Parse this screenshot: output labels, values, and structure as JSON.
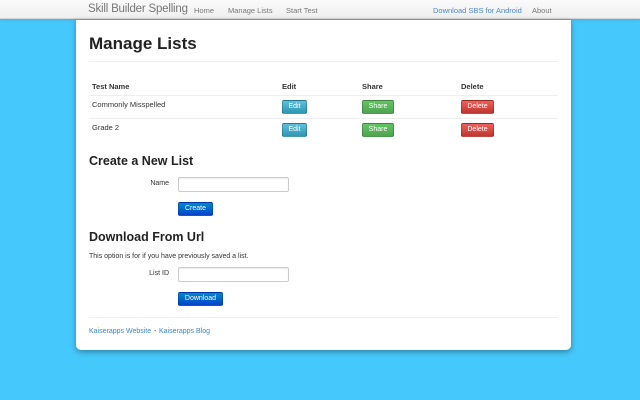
{
  "navbar": {
    "brand": "Skill Builder Spelling",
    "links": [
      "Home",
      "Manage Lists",
      "Start Test"
    ],
    "right_links": [
      "Download SBS for Android",
      "About"
    ]
  },
  "page": {
    "title": "Manage Lists"
  },
  "table": {
    "headers": [
      "Test Name",
      "Edit",
      "Share",
      "Delete"
    ],
    "rows": [
      {
        "name": "Commonly Misspelled",
        "edit": "Edit",
        "share": "Share",
        "delete": "Delete"
      },
      {
        "name": "Grade 2",
        "edit": "Edit",
        "share": "Share",
        "delete": "Delete"
      }
    ]
  },
  "create": {
    "title": "Create a New List",
    "name_label": "Name",
    "name_value": "",
    "button": "Create"
  },
  "download": {
    "title": "Download From Url",
    "help": "This option is for if you have previously saved a list.",
    "id_label": "List ID",
    "id_value": "",
    "button": "Download"
  },
  "footer": {
    "link1": "Kaiserapps Website",
    "separator": "-",
    "link2": "Kaiserapps Blog"
  },
  "colors": {
    "background": "#45c8fb",
    "info": "#2f96b4",
    "success": "#51a351",
    "danger": "#bd362f",
    "primary": "#0044cc"
  }
}
